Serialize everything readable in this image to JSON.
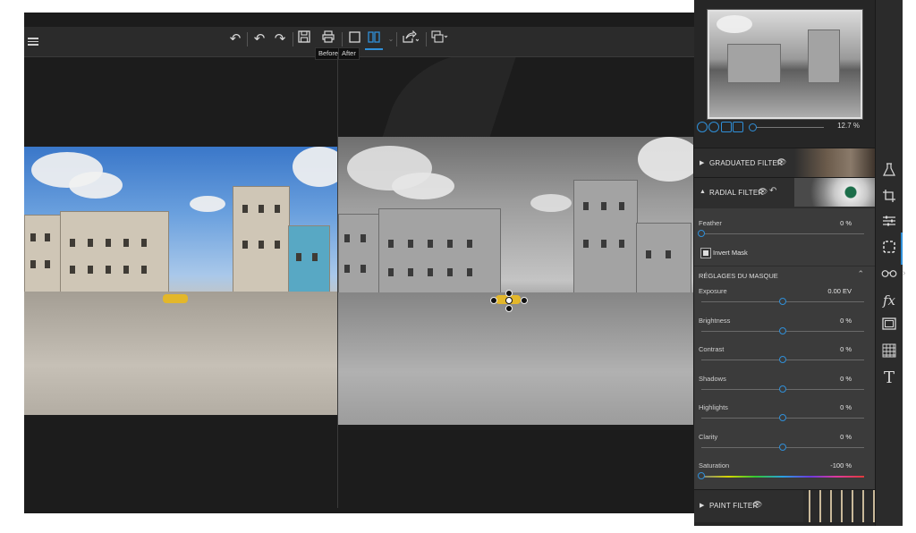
{
  "toolbar": {
    "icons": [
      "hamburger-icon",
      "rotate-left-icon",
      "undo-icon",
      "redo-icon",
      "save-icon",
      "print-icon",
      "single-view-icon",
      "split-view-icon",
      "share-icon",
      "export-icon"
    ],
    "tooltip_before": "Before",
    "tooltip_after": "After"
  },
  "navigator": {
    "zoom_value": "12.7 %"
  },
  "panel": {
    "graduated_filter": "GRADUATED FILTER",
    "radial_filter": "RADIAL FILTER",
    "paint_filter": "PAINT FILTER",
    "feather_label": "Feather",
    "feather_value": "0 %",
    "feather_level": 0,
    "invert_mask_label": "Invert Mask",
    "invert_mask_checked": true,
    "mask_settings_heading": "RÉGLAGES DU MASQUE",
    "sliders": [
      {
        "label": "Exposure",
        "value": "0.00 EV",
        "level": 0.5
      },
      {
        "label": "Brightness",
        "value": "0 %",
        "level": 0.5
      },
      {
        "label": "Contrast",
        "value": "0 %",
        "level": 0.5
      },
      {
        "label": "Shadows",
        "value": "0 %",
        "level": 0.5
      },
      {
        "label": "Highlights",
        "value": "0 %",
        "level": 0.5
      },
      {
        "label": "Clarity",
        "value": "0 %",
        "level": 0.5
      },
      {
        "label": "Saturation",
        "value": "-100 %",
        "level": 0
      }
    ]
  },
  "tools": [
    "flask-icon",
    "crop-icon",
    "sliders-icon",
    "selection-icon",
    "glasses-icon",
    "fx-icon",
    "frame-icon",
    "texture-icon",
    "text-icon"
  ],
  "tool_glyphs": {
    "fx": "fx",
    "text": "T"
  },
  "colors": {
    "accent": "#2f8fd8",
    "panel_bg": "#262626",
    "body_bg": "#3b3b3b"
  }
}
